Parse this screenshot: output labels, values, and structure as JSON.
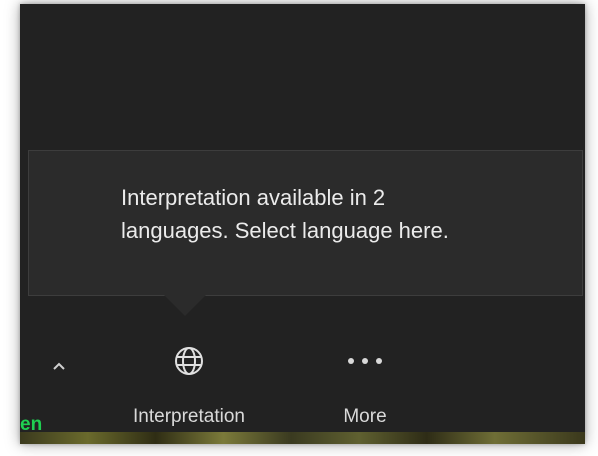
{
  "tooltip": {
    "line1": "Interpretation available in 2",
    "line2": "languages. Select language here."
  },
  "toolbar": {
    "caret_icon": "chevron-up-icon",
    "partial_label": "en",
    "interpretation": {
      "label": "Interpretation",
      "icon": "globe-icon"
    },
    "more": {
      "label": "More",
      "icon": "ellipsis-icon"
    }
  },
  "colors": {
    "background": "#222222",
    "tooltip_bg": "#2b2b2b",
    "text": "#ebebeb",
    "accent_green": "#1fcf51"
  }
}
